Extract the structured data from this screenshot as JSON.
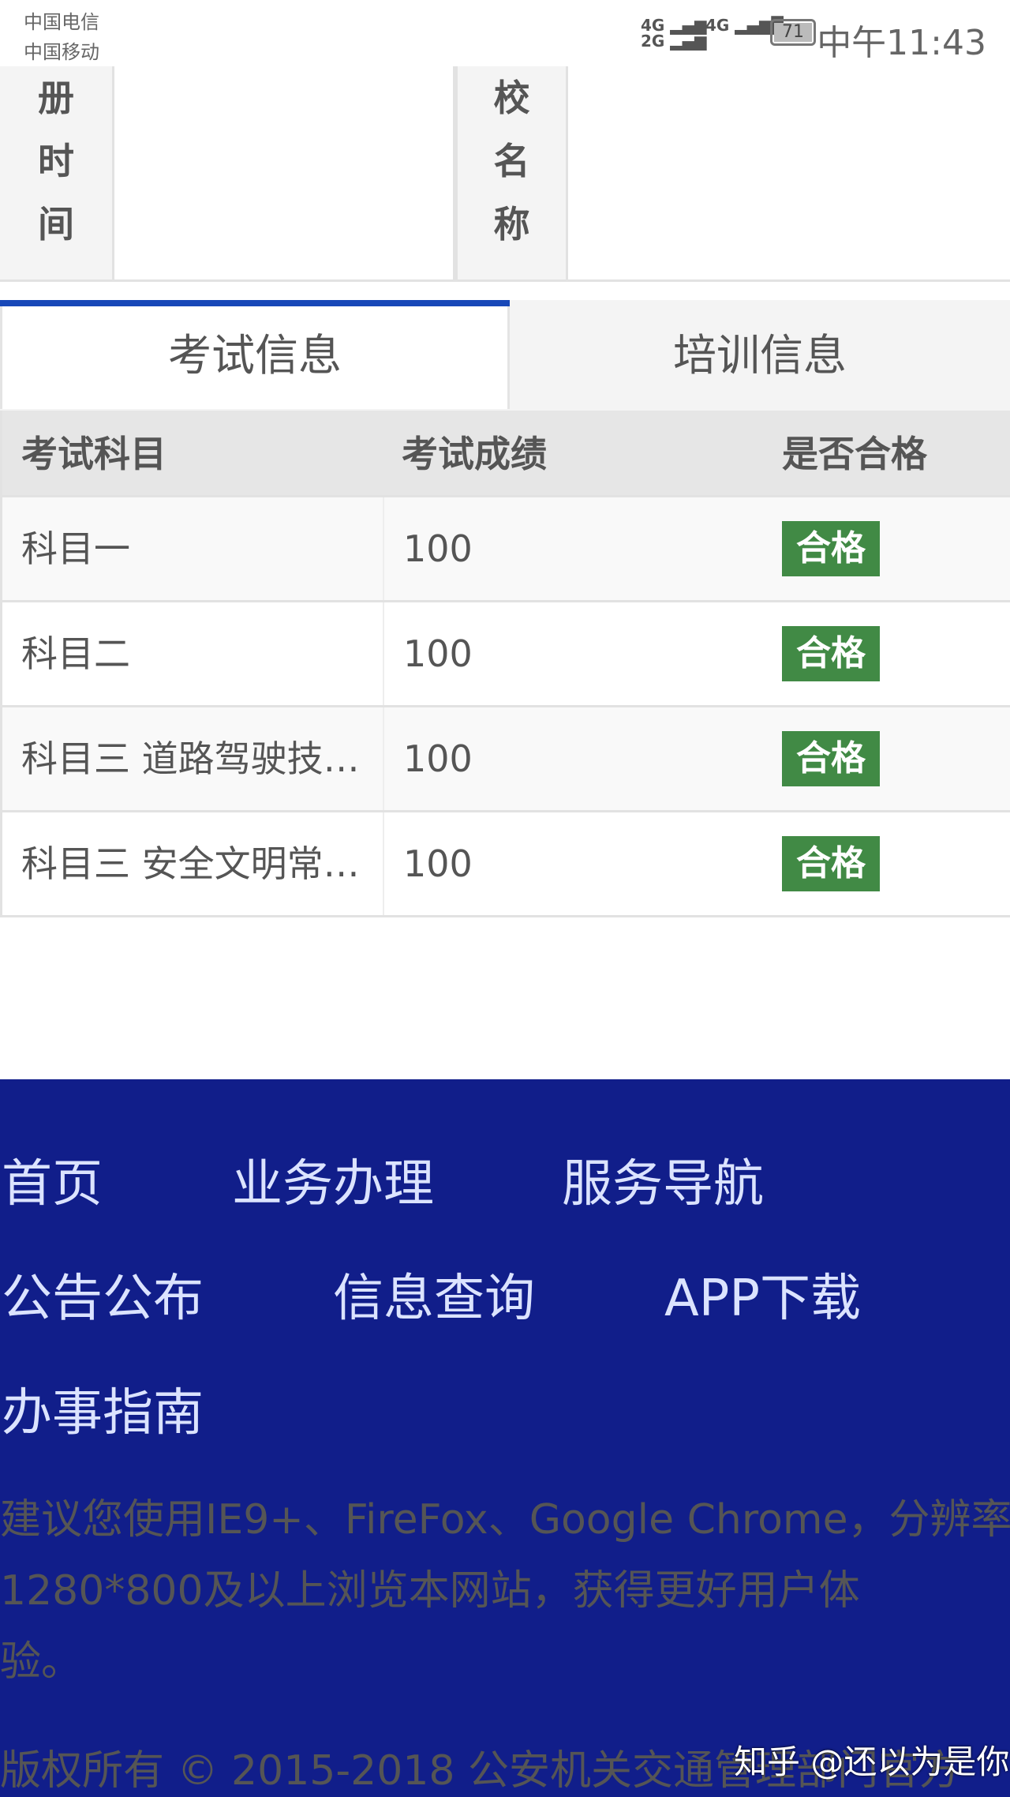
{
  "status_bar": {
    "carrier1": "中国电信",
    "carrier2": "中国移动",
    "signal1": "4G",
    "signal1b": "2G",
    "signal2": "4G",
    "battery": "71",
    "time": "中午11:43"
  },
  "info_table": {
    "label_left": [
      "册",
      "时",
      "间"
    ],
    "label_right": [
      "校",
      "名",
      "称"
    ],
    "value_left": "",
    "value_right": ""
  },
  "tabs": [
    {
      "label": "考试信息",
      "active": true
    },
    {
      "label": "培训信息",
      "active": false
    }
  ],
  "exam_table": {
    "headers": [
      "考试科目",
      "考试成绩",
      "是否合格"
    ],
    "rows": [
      {
        "subject": "科目一",
        "score": "100",
        "result": "合格"
      },
      {
        "subject": "科目二",
        "score": "100",
        "result": "合格"
      },
      {
        "subject": "科目三 道路驾驶技…",
        "score": "100",
        "result": "合格"
      },
      {
        "subject": "科目三 安全文明常…",
        "score": "100",
        "result": "合格"
      }
    ],
    "pass_color": "#418a45"
  },
  "footer": {
    "nav": [
      "首页",
      "业务办理",
      "服务导航",
      "公告公布",
      "信息查询",
      "APP下载",
      "办事指南"
    ],
    "notice_lines": [
      "建议您使用IE9+、FireFox、Google Chrome，分辨率",
      "1280*800及以上浏览本网站，获得更好用户体",
      "验。"
    ],
    "copyright": "版权所有 © 2015-2018 公安机关交通管理部门官方"
  },
  "watermark": "知乎 @还以为是你",
  "colors": {
    "footer_bg": "#111e8a",
    "tab_accent": "#1848b8"
  }
}
